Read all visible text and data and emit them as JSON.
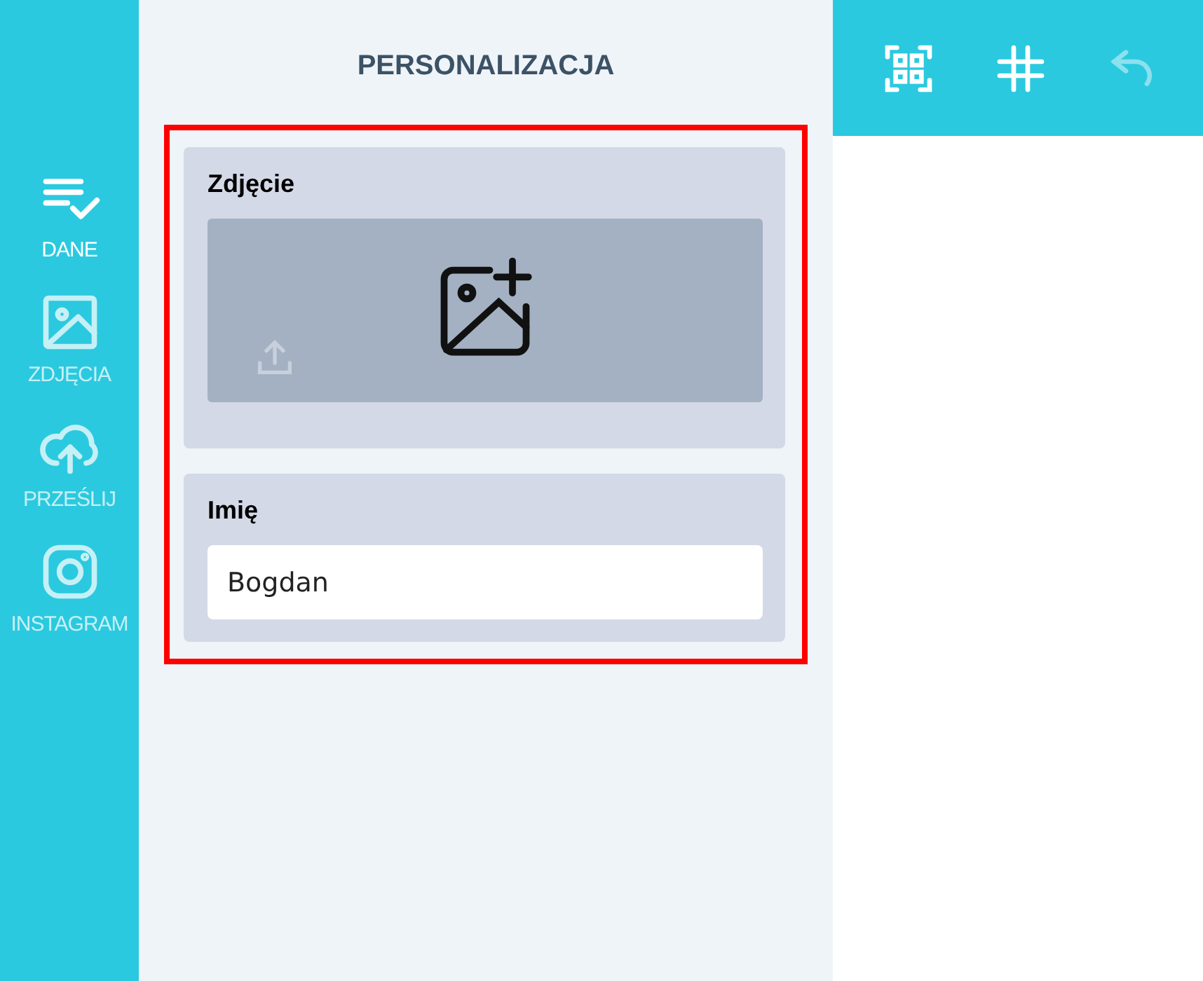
{
  "sidebar": {
    "items": [
      {
        "label": "DANE",
        "kind": "list",
        "selected": true
      },
      {
        "label": "ZDJĘCIA",
        "kind": "image",
        "selected": false
      },
      {
        "label": "PRZEŚLIJ",
        "kind": "upload",
        "selected": false
      },
      {
        "label": "INSTAGRAM",
        "kind": "social",
        "selected": false
      }
    ]
  },
  "panel": {
    "title": "PERSONALIZACJA",
    "highlighted": true,
    "fields": [
      {
        "kind": "image",
        "label": "Zdjęcie"
      },
      {
        "kind": "text",
        "label": "Imię",
        "value": "Bogdan"
      }
    ]
  },
  "toolbar": [
    {
      "kind": "qr",
      "disabled": false
    },
    {
      "kind": "grid",
      "disabled": false
    },
    {
      "kind": "undo",
      "disabled": true
    }
  ]
}
